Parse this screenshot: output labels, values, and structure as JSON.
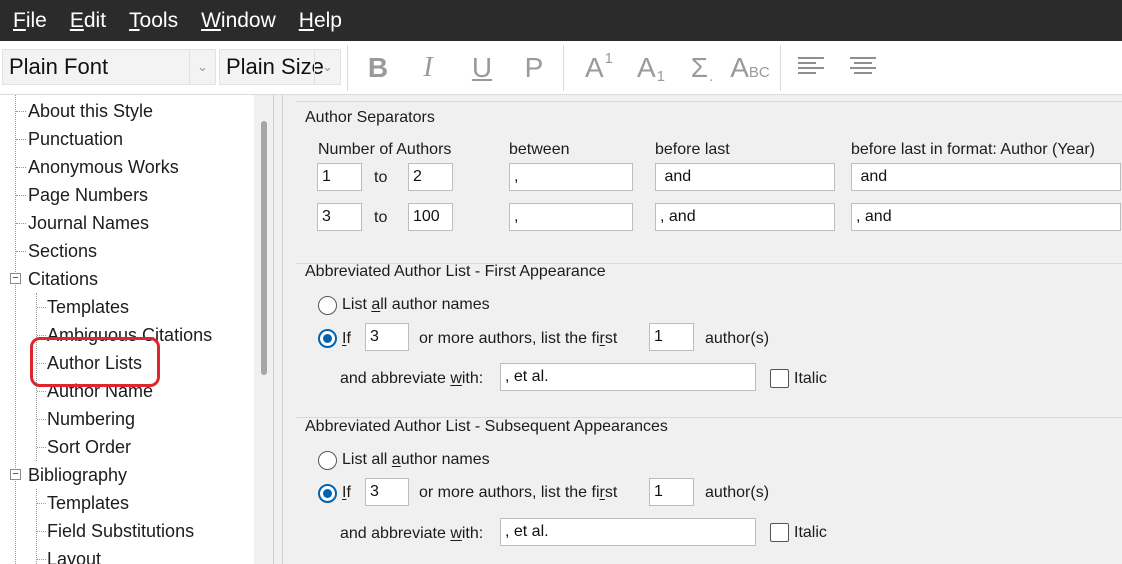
{
  "menu": [
    {
      "label": "File",
      "key": "F",
      "rest": "ile"
    },
    {
      "label": "Edit",
      "key": "E",
      "rest": "dit"
    },
    {
      "label": "Tools",
      "key": "T",
      "rest": "ools"
    },
    {
      "label": "Window",
      "key": "W",
      "rest": "indow"
    },
    {
      "label": "Help",
      "key": "H",
      "rest": "elp"
    }
  ],
  "toolbar": {
    "font": "Plain Font",
    "size": "Plain Size",
    "bold": "B",
    "italic": "I",
    "underline": "U",
    "plain": "P",
    "superscript_base": "A",
    "superscript_mark": "1",
    "subscript_base": "A",
    "subscript_mark": "1",
    "symbol": "Σ",
    "symbol_mark": ".",
    "smallcaps_base": "A",
    "smallcaps_mark": "BC"
  },
  "tree": {
    "items": [
      "About this Style",
      "Punctuation",
      "Anonymous Works",
      "Page Numbers",
      "Journal Names",
      "Sections",
      "Citations",
      "Templates",
      "Ambiguous Citations",
      "Author Lists",
      "Author Name",
      "Numbering",
      "Sort Order",
      "Bibliography",
      "Templates",
      "Field Substitutions",
      "Layout"
    ],
    "selected": "Author Lists",
    "expander": "−"
  },
  "separators": {
    "title": "Author Separators",
    "col_number": "Number of Authors",
    "col_between": "between",
    "col_before_last": "before last",
    "col_before_last_format": "before last in format: Author (Year)",
    "to": "to",
    "rows": [
      {
        "from": "1",
        "to": "2",
        "between": ",",
        "before_last": " and",
        "before_last_format": " and"
      },
      {
        "from": "3",
        "to": "100",
        "between": ",",
        "before_last": ", and",
        "before_last_format": ", and"
      }
    ]
  },
  "first": {
    "title": "Abbreviated Author List - First Appearance",
    "list_all_pre": "List ",
    "list_all_key": "a",
    "list_all_post": "ll author names",
    "if_key": "I",
    "if_rest": "f",
    "count": "3",
    "or_more_pre": "or more authors, list the fi",
    "or_more_key": "r",
    "or_more_post": "st",
    "first_n": "1",
    "authors": "author(s)",
    "abbr_pre": "and abbreviate ",
    "abbr_key": "w",
    "abbr_post": "ith:",
    "abbr_value": ", et al.",
    "italic": "Italic",
    "italic_checked": false,
    "selected": "if"
  },
  "subsequent": {
    "title": "Abbreviated Author List - Subsequent Appearances",
    "list_all_pre": "List all ",
    "list_all_key": "a",
    "list_all_post": "uthor names",
    "if_key": "I",
    "if_rest": "f",
    "count": "3",
    "or_more_pre": "or more authors, list the fi",
    "or_more_key": "r",
    "or_more_post": "st",
    "first_n": "1",
    "authors": "author(s)",
    "abbr_pre": "and abbreviate ",
    "abbr_key": "w",
    "abbr_post": "ith:",
    "abbr_value": ", et al.",
    "italic": "Italic",
    "italic_checked": false,
    "selected": "if"
  },
  "colors": {
    "menubar": "#2b2b2b",
    "accent": "#0063b1",
    "highlight": "#e0252f"
  }
}
